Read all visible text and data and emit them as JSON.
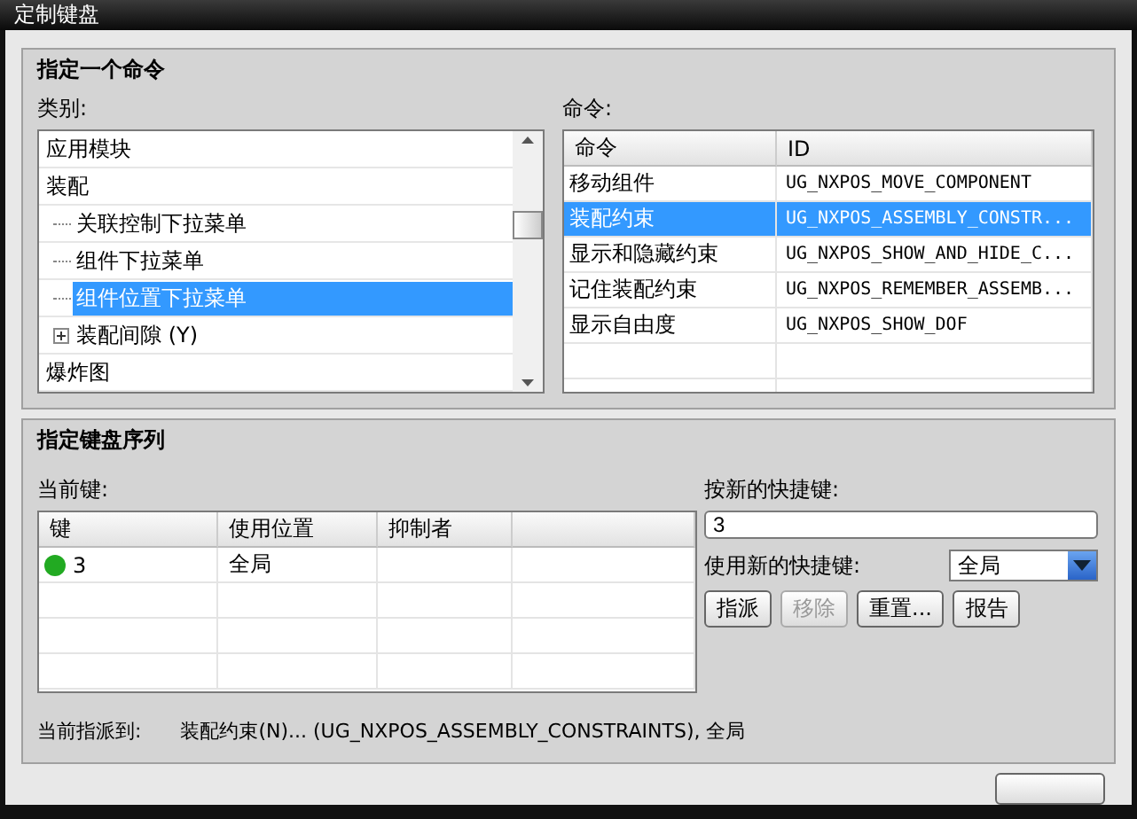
{
  "window": {
    "title": "定制键盘"
  },
  "command_group": {
    "title": "指定一个命令",
    "category_label": "类别:",
    "categories": [
      {
        "label": "应用模块",
        "selected": false
      },
      {
        "label": "装配",
        "selected": false,
        "children": [
          {
            "label": "关联控制下拉菜单",
            "selected": false
          },
          {
            "label": "组件下拉菜单",
            "selected": false
          },
          {
            "label": "组件位置下拉菜单",
            "selected": true
          },
          {
            "label": "装配间隙 (Y)",
            "selected": false,
            "expanded": false
          }
        ]
      },
      {
        "label": "爆炸图",
        "selected": false
      }
    ],
    "commands_label": "命令:",
    "commands_columns": [
      "命令",
      "ID"
    ],
    "commands": [
      {
        "name": "移动组件",
        "id": "UG_NXPOS_MOVE_COMPONENT",
        "selected": false
      },
      {
        "name": "装配约束",
        "id": "UG_NXPOS_ASSEMBLY_CONSTR...",
        "selected": true
      },
      {
        "name": "显示和隐藏约束",
        "id": "UG_NXPOS_SHOW_AND_HIDE_C...",
        "selected": false
      },
      {
        "name": "记住装配约束",
        "id": "UG_NXPOS_REMEMBER_ASSEMB...",
        "selected": false
      },
      {
        "name": "显示自由度",
        "id": "UG_NXPOS_SHOW_DOF",
        "selected": false
      }
    ]
  },
  "key_group": {
    "title": "指定键盘序列",
    "current_keys_label": "当前键:",
    "key_columns": [
      "键",
      "使用位置",
      "抑制者"
    ],
    "keys": [
      {
        "key": "3",
        "location": "全局",
        "color": "#22aa22"
      }
    ],
    "new_key_label": "按新的快捷键:",
    "new_key_value": "3",
    "use_label": "使用新的快捷键:",
    "use_value": "全局",
    "buttons": [
      {
        "label": "指派",
        "disabled": false
      },
      {
        "label": "移除",
        "disabled": true
      },
      {
        "label": "重置...",
        "disabled": false
      },
      {
        "label": "报告",
        "disabled": false
      }
    ],
    "assigned_label": "当前指派到:",
    "assigned_value": "装配约束(N)... (UG_NXPOS_ASSEMBLY_CONSTRAINTS), 全局"
  }
}
